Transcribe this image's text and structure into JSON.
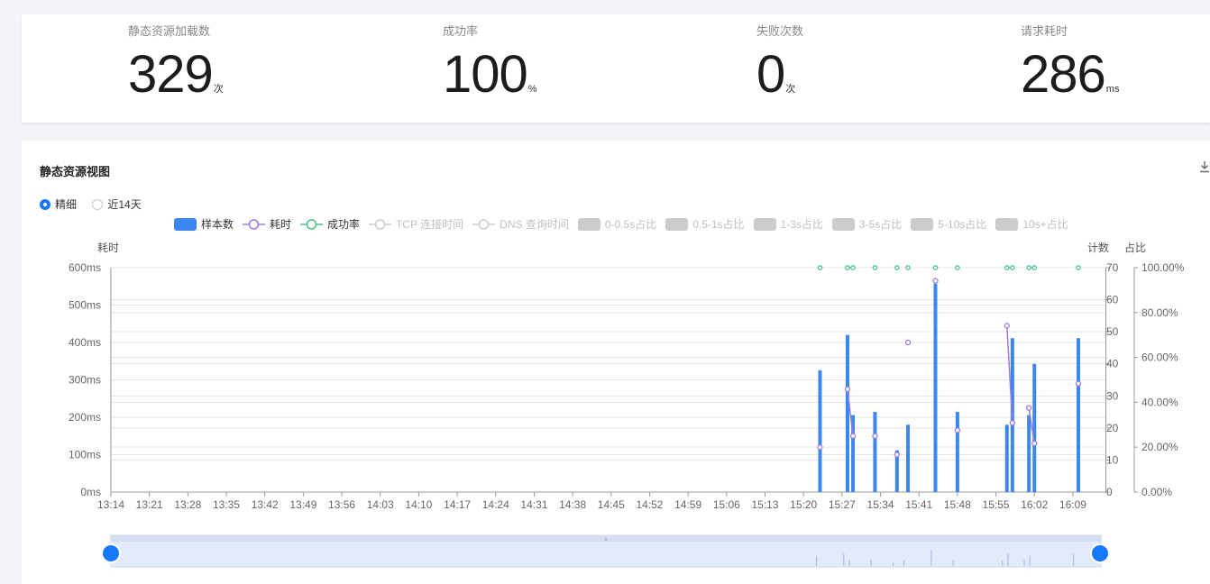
{
  "stats": [
    {
      "label": "静态资源加载数",
      "value": "329",
      "unit": "次"
    },
    {
      "label": "成功率",
      "value": "100",
      "unit": "%"
    },
    {
      "label": "失败次数",
      "value": "0",
      "unit": "次"
    },
    {
      "label": "请求耗时",
      "value": "286",
      "unit": "ms"
    }
  ],
  "chart_panel": {
    "title": "静态资源视图",
    "modes": [
      {
        "label": "精细",
        "selected": true
      },
      {
        "label": "近14天",
        "selected": false
      }
    ],
    "legend": [
      {
        "label": "样本数",
        "kind": "rect",
        "color": "#3b86f0",
        "active": true
      },
      {
        "label": "耗时",
        "kind": "line",
        "color": "#9b7be0",
        "active": true
      },
      {
        "label": "成功率",
        "kind": "line",
        "color": "#4cc28a",
        "active": true
      },
      {
        "label": "TCP 连接时间",
        "kind": "line",
        "color": "#cccccc",
        "active": false
      },
      {
        "label": "DNS 查询时间",
        "kind": "line",
        "color": "#cccccc",
        "active": false
      },
      {
        "label": "0-0.5s占比",
        "kind": "rect",
        "color": "#cccccc",
        "active": false
      },
      {
        "label": "0.5-1s占比",
        "kind": "rect",
        "color": "#cccccc",
        "active": false
      },
      {
        "label": "1-3s占比",
        "kind": "rect",
        "color": "#cccccc",
        "active": false
      },
      {
        "label": "3-5s占比",
        "kind": "rect",
        "color": "#cccccc",
        "active": false
      },
      {
        "label": "5-10s占比",
        "kind": "rect",
        "color": "#cccccc",
        "active": false
      },
      {
        "label": "10s+占比",
        "kind": "rect",
        "color": "#cccccc",
        "active": false
      }
    ]
  },
  "chart_data": {
    "type": "bar",
    "axis_names": {
      "left": "耗时",
      "right_count": "计数",
      "right_ratio": "占比"
    },
    "x_ticks": [
      "13:14",
      "13:21",
      "13:28",
      "13:35",
      "13:42",
      "13:49",
      "13:56",
      "14:03",
      "14:10",
      "14:17",
      "14:24",
      "14:31",
      "14:38",
      "14:45",
      "14:52",
      "14:59",
      "15:06",
      "15:13",
      "15:20",
      "15:27",
      "15:34",
      "15:41",
      "15:48",
      "15:55",
      "16:02",
      "16:09"
    ],
    "x_range_minutes": [
      0,
      181
    ],
    "left_axis": {
      "ticks": [
        "0ms",
        "100ms",
        "200ms",
        "300ms",
        "400ms",
        "500ms",
        "600ms"
      ],
      "range": [
        0,
        600
      ]
    },
    "count_axis": {
      "ticks": [
        "0",
        "10",
        "20",
        "30",
        "40",
        "50",
        "60",
        "70"
      ],
      "range": [
        0,
        70
      ]
    },
    "ratio_axis": {
      "ticks": [
        "0.00%",
        "20.00%",
        "40.00%",
        "60.00%",
        "80.00%",
        "100.00%"
      ],
      "range": [
        0,
        100
      ]
    },
    "bars": {
      "name": "样本数",
      "color": "#3b86f0",
      "points": [
        [
          129,
          38
        ],
        [
          134,
          49
        ],
        [
          135,
          24
        ],
        [
          139,
          25
        ],
        [
          143,
          13
        ],
        [
          145,
          21
        ],
        [
          150,
          65
        ],
        [
          154,
          25
        ],
        [
          163,
          21
        ],
        [
          164,
          48
        ],
        [
          167,
          24
        ],
        [
          168,
          40
        ],
        [
          176,
          48
        ]
      ]
    },
    "duration": {
      "name": "耗时",
      "color": "#9b7be0",
      "points": [
        [
          129,
          120
        ],
        [
          134,
          275
        ],
        [
          135,
          150
        ],
        [
          139,
          150
        ],
        [
          143,
          100
        ],
        [
          145,
          400
        ],
        [
          150,
          565
        ],
        [
          154,
          165
        ],
        [
          163,
          445
        ],
        [
          164,
          185
        ],
        [
          167,
          225
        ],
        [
          168,
          130
        ],
        [
          176,
          290
        ]
      ]
    },
    "success": {
      "name": "成功率",
      "color": "#4cc28a",
      "points": [
        [
          129,
          100
        ],
        [
          134,
          100
        ],
        [
          135,
          100
        ],
        [
          139,
          100
        ],
        [
          143,
          100
        ],
        [
          145,
          100
        ],
        [
          150,
          100
        ],
        [
          154,
          100
        ],
        [
          163,
          100
        ],
        [
          164,
          100
        ],
        [
          167,
          100
        ],
        [
          168,
          100
        ],
        [
          176,
          100
        ]
      ]
    }
  }
}
